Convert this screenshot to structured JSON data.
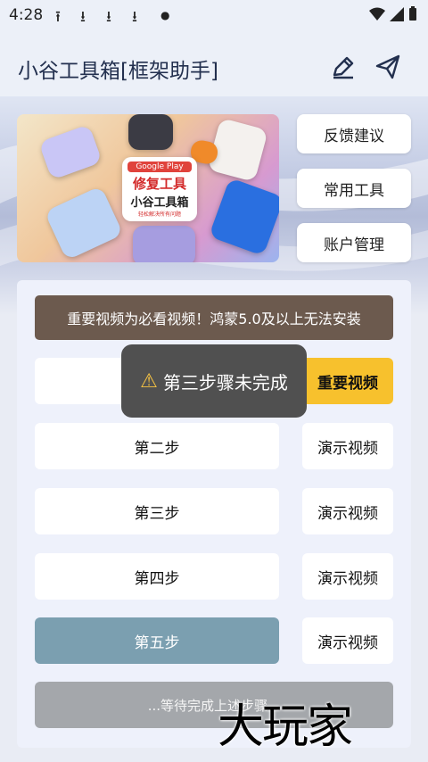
{
  "status_bar": {
    "time": "4:28",
    "notifications": [
      "upload-icon",
      "download-icon",
      "download-icon",
      "download-icon",
      "dot-icon"
    ],
    "icons": [
      "wifi-icon",
      "signal-icon",
      "battery-icon"
    ]
  },
  "app_bar": {
    "title": "小谷工具箱[框架助手]",
    "actions": [
      "edit-icon",
      "send-icon"
    ]
  },
  "banner": {
    "badge_line1": "Google Play",
    "badge_line2": "修复工具",
    "badge_line3": "小谷工具箱",
    "badge_line4": "轻松解决所有问题"
  },
  "side_buttons": [
    "反馈建议",
    "常用工具",
    "账户管理"
  ],
  "notice": "重要视频为必看视频！鸿蒙5.0及以上无法安装",
  "steps": [
    {
      "label": "",
      "video": "重要视频"
    },
    {
      "label": "第二步",
      "video": "演示视频"
    },
    {
      "label": "第三步",
      "video": "演示视频"
    },
    {
      "label": "第四步",
      "video": "演示视频"
    },
    {
      "label": "第五步",
      "video": "演示视频"
    }
  ],
  "waiting": "...等待完成上述步骤...",
  "toast": "第三步骤未完成",
  "watermark": "大玩家",
  "colors": {
    "notice_bg": "#6c5a4e",
    "key_video": "#f7c12d",
    "active_step": "#7b9fb0",
    "waiting_bg": "#a4a7ab",
    "title": "#23304f"
  }
}
